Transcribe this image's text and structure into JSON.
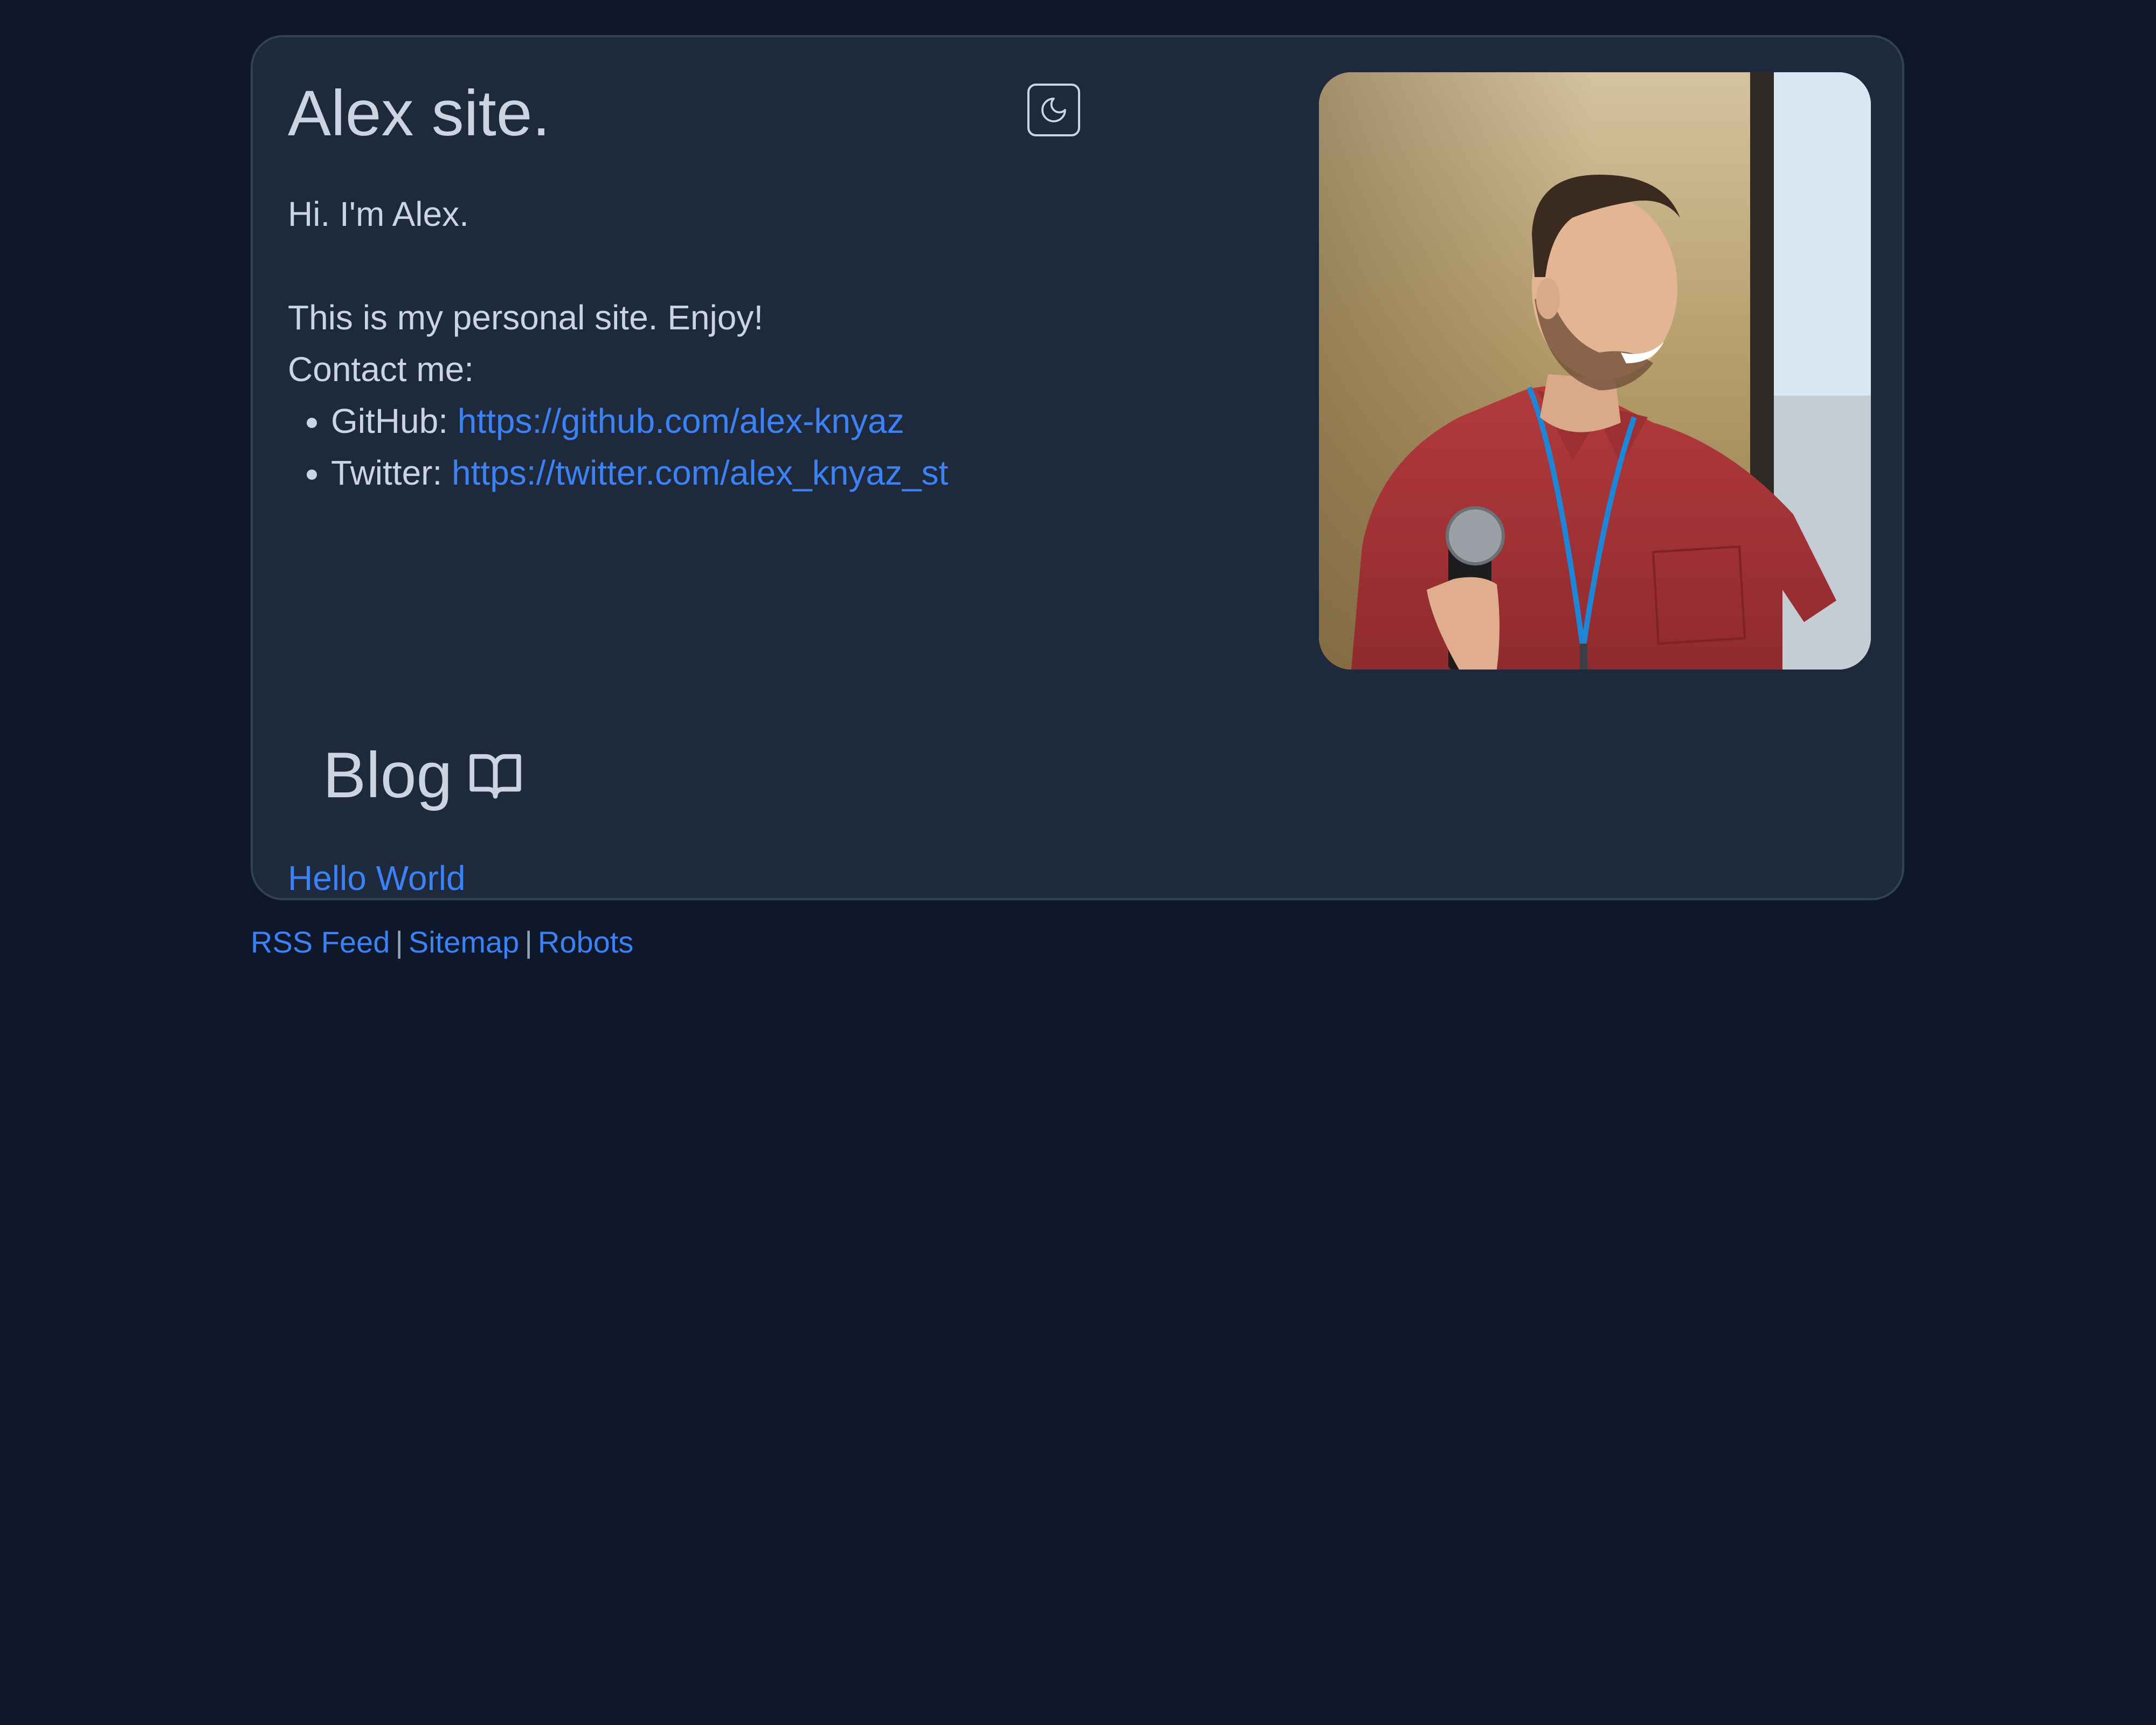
{
  "site": {
    "title": "Alex site.",
    "theme_toggle_icon": "moon-icon"
  },
  "intro": {
    "greeting": "Hi. I'm Alex.",
    "welcome": "This is my personal site. Enjoy!",
    "contact_heading": "Contact me:",
    "contacts": [
      {
        "label": "GitHub:",
        "url": "https://github.com/alex-knyaz"
      },
      {
        "label": "Twitter:",
        "url": "https://twitter.com/alex_knyaz_st"
      }
    ]
  },
  "blog": {
    "heading": "Blog",
    "heading_icon": "book-open-icon",
    "posts": [
      {
        "title": "Hello World"
      }
    ]
  },
  "footer": {
    "links": [
      "RSS Feed",
      "Sitemap",
      "Robots"
    ],
    "separator": "|"
  },
  "colors": {
    "page_background": "#0f172a",
    "card_background": "#1e293b",
    "card_border": "#334155",
    "text": "#cbd5e1",
    "link": "#3b82f6"
  }
}
